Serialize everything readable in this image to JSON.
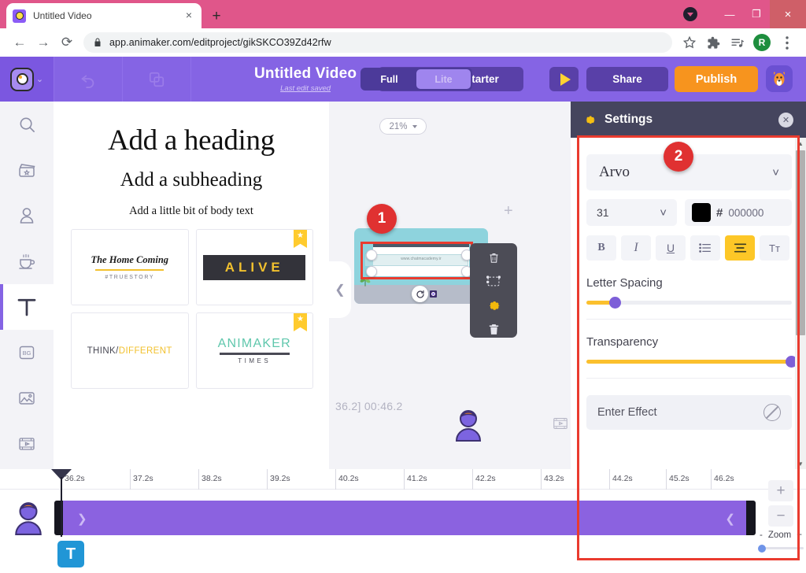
{
  "browser": {
    "tab": {
      "title": "Untitled Video",
      "favicon": "animaker-favicon-icon",
      "close": "×"
    },
    "newtab_label": "+",
    "window_controls": {
      "minimize": "—",
      "maximize": "❐",
      "close": "×"
    },
    "nav": {
      "back": "←",
      "forward": "→",
      "reload": "⟳"
    },
    "url": "app.animaker.com/editproject/gikSKCO39Zd42rfw",
    "toolbar_icons": [
      "star-icon",
      "extensions-icon",
      "playlist-icon",
      "menu-icon"
    ],
    "profile_initial": "R"
  },
  "app_header": {
    "logo": "animaker-logo-icon",
    "logo_caret": "⌄",
    "undo": "undo-icon",
    "duplicate": "duplicate-icon",
    "project_title": "Untitled Video",
    "save_status": "Last edit saved",
    "upgrade_label": "e to starter",
    "mode": {
      "full": "Full",
      "lite": "Lite",
      "selected": "Lite"
    },
    "preview": "play-icon",
    "share_label": "Share",
    "publish_label": "Publish",
    "mascot": "mascot-icon"
  },
  "sidebar": {
    "items": [
      {
        "name": "search",
        "icon": "search-icon",
        "active": false
      },
      {
        "name": "video",
        "icon": "clapper-icon",
        "active": false
      },
      {
        "name": "character",
        "icon": "character-icon",
        "active": false
      },
      {
        "name": "props",
        "icon": "props-cup-icon",
        "active": false
      },
      {
        "name": "text",
        "icon": "text-t-icon",
        "active": true
      },
      {
        "name": "bg",
        "icon": "bg-icon",
        "active": false,
        "label": "BG"
      },
      {
        "name": "image",
        "icon": "image-icon",
        "active": false
      },
      {
        "name": "music",
        "icon": "music-icon",
        "active": false
      },
      {
        "name": "effects",
        "icon": "effects-icon",
        "active": false
      }
    ]
  },
  "text_library": {
    "heading": "Add a heading",
    "subheading": "Add a subheading",
    "body": "Add a little bit of body text",
    "collapse_icon": "chevron-left-icon",
    "cards": [
      {
        "id": "home-coming",
        "title": "The Home Coming",
        "sub": "#TRUESTORY",
        "premium": false
      },
      {
        "id": "alive",
        "title": "ALIVE",
        "premium": true
      },
      {
        "id": "think-different",
        "title": "THINK/",
        "title2": "DIFFERENT",
        "premium": false
      },
      {
        "id": "animaker-times",
        "title": "ANIMAKER",
        "sub": "TIMES",
        "premium": true
      }
    ],
    "premium_badge": "★"
  },
  "stage": {
    "zoom_level": "21%",
    "zoom_caret": "▾",
    "slide_url_text": "www.chatmacademy.ir",
    "add_scene": "+",
    "rotate_icon": "rotate-icon",
    "callout_1": "1",
    "context_toolbar": [
      {
        "name": "copy-top",
        "icon": "trash-top-icon"
      },
      {
        "name": "crop",
        "icon": "crop-select-icon"
      },
      {
        "name": "settings",
        "icon": "gear-icon"
      },
      {
        "name": "delete",
        "icon": "trash-icon"
      }
    ],
    "timecode": "36.2]  00:46.2",
    "character_icon": "character-avatar-icon",
    "film_icon": "film-icon"
  },
  "settings": {
    "title": "Settings",
    "gear_icon": "gear-icon",
    "close_icon": "close-icon",
    "callout_2": "2",
    "font_family": "Arvo",
    "font_family_caret": "⌄",
    "font_size": "31",
    "font_size_caret": "⌄",
    "color_hash": "#",
    "color_hex": "000000",
    "color_swatch": "#000000",
    "format_buttons": [
      {
        "name": "bold",
        "label": "B",
        "active": false
      },
      {
        "name": "italic",
        "label": "I",
        "active": false
      },
      {
        "name": "underline",
        "label": "U",
        "active": false
      },
      {
        "name": "bullet-list",
        "label": "☰",
        "active": false
      },
      {
        "name": "align",
        "label": "≡",
        "active": true
      },
      {
        "name": "text-case",
        "label": "Tᴛ",
        "active": false
      }
    ],
    "letter_spacing_label": "Letter Spacing",
    "letter_spacing_value": 13,
    "transparency_label": "Transparency",
    "transparency_value": 100,
    "enter_effect_label": "Enter Effect",
    "enter_effect_icon": "no-effect-icon",
    "scroll_up": "▲",
    "scroll_down": "▼",
    "scroll_left": "◀",
    "scroll_right": "▶"
  },
  "timeline": {
    "ticks": [
      "36.2s",
      "37.2s",
      "38.2s",
      "39.2s",
      "40.2s",
      "41.2s",
      "42.2s",
      "43.2s",
      "44.2s",
      "45.2s",
      "46.2s"
    ],
    "clip_arrow_left": "❯",
    "clip_arrow_right": "❮",
    "track_icon": "character-avatar-icon",
    "text_chip_label": "T",
    "zoom_in": "+",
    "zoom_out": "−",
    "zoom_label": "Zoom",
    "zoom_minus": "-",
    "zoom_plus": "+",
    "zoom_slider_value": 3
  },
  "colors": {
    "browser_pink": "#e0568a",
    "app_purple": "#8564e4",
    "publish_orange": "#f7941e",
    "accent_yellow": "#fdc727",
    "callout_red": "#e03131",
    "settings_header": "#45455e",
    "clip_purple": "#8b62e0"
  }
}
